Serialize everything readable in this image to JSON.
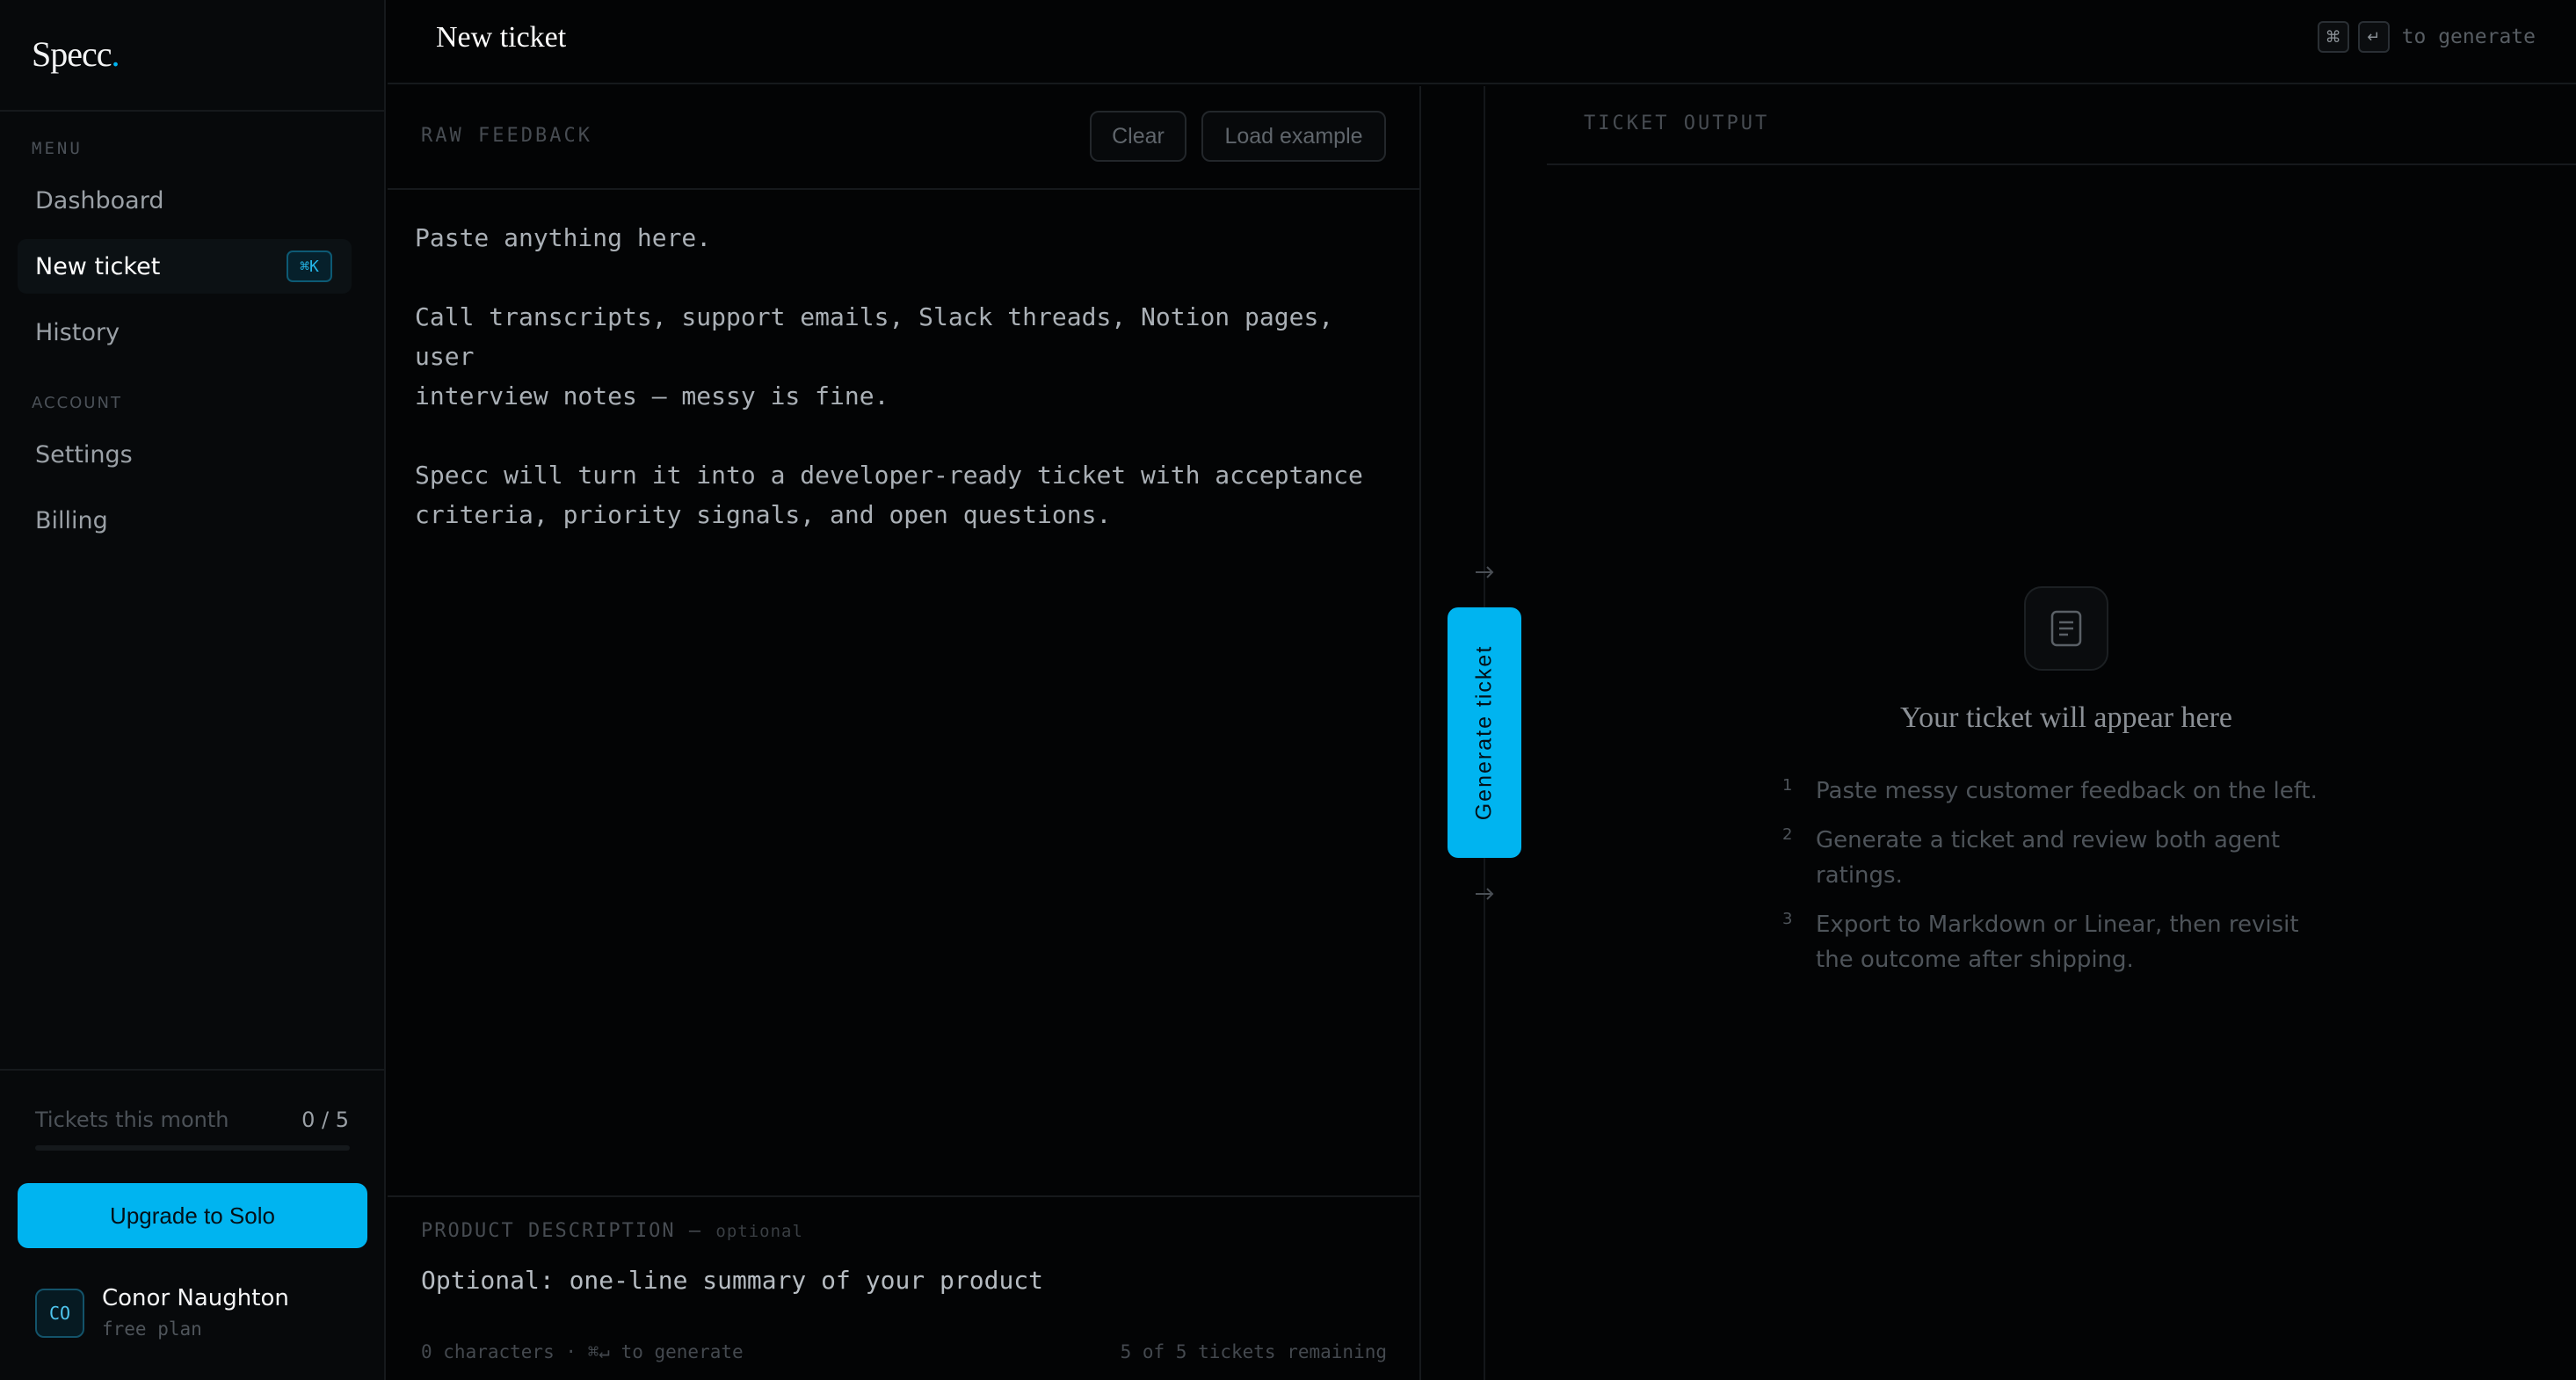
{
  "app": {
    "name": "Specc"
  },
  "sidebar": {
    "menu_heading": "MENU",
    "menu_items": [
      {
        "label": "Dashboard"
      },
      {
        "label": "New ticket",
        "shortcut": "⌘K",
        "active": true
      },
      {
        "label": "History"
      }
    ],
    "account_heading": "ACCOUNT",
    "account_items": [
      {
        "label": "Settings"
      },
      {
        "label": "Billing"
      }
    ],
    "usage": {
      "label": "Tickets this month",
      "value": "0 / 5",
      "fraction": 0
    },
    "upgrade_label": "Upgrade to Solo",
    "user": {
      "initials": "CO",
      "name": "Conor Naughton",
      "plan": "free plan"
    }
  },
  "header": {
    "title": "New ticket",
    "hint_keys": [
      "⌘",
      "↵"
    ],
    "hint_text": "to generate"
  },
  "input_pane": {
    "label": "RAW FEEDBACK",
    "clear_label": "Clear",
    "load_example_label": "Load example",
    "placeholder": "Paste anything here.\n\nCall transcripts, support emails, Slack threads, Notion pages, user\ninterview notes — messy is fine.\n\nSpecc will turn it into a developer-ready ticket with acceptance\ncriteria, priority signals, and open questions.",
    "product_description": {
      "label": "PRODUCT DESCRIPTION —",
      "optional": "optional",
      "placeholder": "Optional: one-line summary of your product"
    },
    "footer_left": "0 characters · ⌘↵ to generate",
    "footer_right": "5 of 5 tickets remaining"
  },
  "generate": {
    "label": "Generate ticket",
    "arrow_icon": "arrow-right-icon"
  },
  "output_pane": {
    "label": "TICKET OUTPUT",
    "empty_icon": "document-icon",
    "empty_title": "Your ticket will appear here",
    "steps": [
      {
        "num": "1",
        "text": "Paste messy customer feedback on the left."
      },
      {
        "num": "2",
        "text": "Generate a ticket and review both agent ratings."
      },
      {
        "num": "3",
        "text": "Export to Markdown or Linear, then revisit the outcome after shipping."
      }
    ]
  },
  "colors": {
    "accent": "#00b4f0",
    "background": "#030405",
    "sidebar": "#07090b"
  }
}
